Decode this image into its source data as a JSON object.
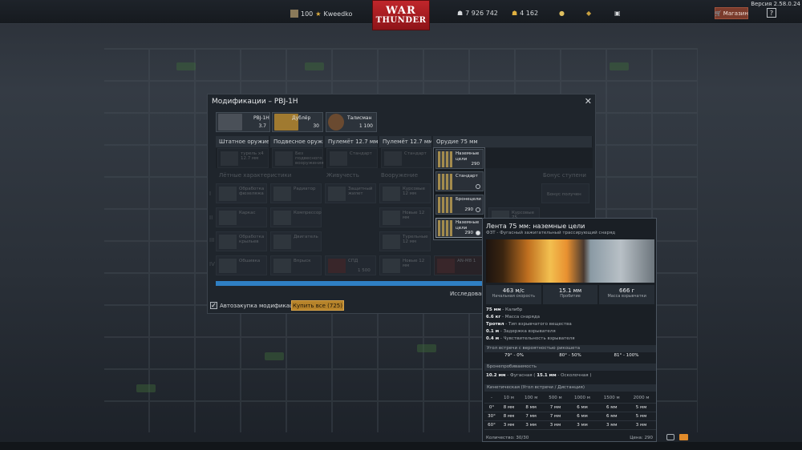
{
  "topbar": {
    "version": "Версия 2.58.0.24",
    "rank": "100",
    "username": "Kweedko",
    "silver_lions": "7 926 742",
    "golden_eagles": "4 162",
    "logo_line1": "WAR",
    "logo_line2": "THUNDER",
    "shop": "Магазин",
    "help": "?"
  },
  "dialog": {
    "title": "Модификации – PBJ-1H",
    "close": "✕",
    "slots": [
      {
        "name": "PBJ-1H",
        "value": "3.7"
      },
      {
        "name": "Дублёр",
        "value": "30"
      },
      {
        "name": "Талисман",
        "value": "1 100"
      }
    ],
    "categories": [
      "Штатное оружие",
      "Подвесное оружие",
      "Пулемёт 12.7 мм",
      "Пулемёт 12.7 мм",
      "Орудие 75 мм"
    ],
    "row1": [
      "турель x4 12.7 мм",
      "Без подвесного вооружения",
      "Стандарт",
      "Стандарт"
    ],
    "sections": [
      "Лётные характеристики",
      "Живучесть",
      "Вооружение",
      "Бонус ступени"
    ],
    "tiers": [
      "I",
      "II",
      "III",
      "IV"
    ],
    "mods": [
      "Обработка фюзеляжа",
      "Радиатор",
      "Защитный жилет",
      "Курсовые 12 мм",
      "Каркас",
      "Компрессор",
      "Новые 12 мм",
      "Курсовые 75",
      "Обработка крыльев",
      "Двигатель",
      "Турельные 12 мм",
      "Обшивка",
      "Впрыск",
      "СПД",
      "Новые 12 мм",
      "AN-M8 1"
    ],
    "bonus": "Бонус получен",
    "spd_price": "1 500",
    "research": "Исследовани",
    "autobuy": "Автозакупка модификаций",
    "buy_all": "Купить все (725)"
  },
  "dropdown": [
    {
      "name": "Наземные цели",
      "price": "290",
      "selected": false
    },
    {
      "name": "Стандарт",
      "price": "",
      "selected": false
    },
    {
      "name": "Бронецели",
      "price": "290",
      "selected": false
    },
    {
      "name": "Наземные цели",
      "price": "290",
      "selected": true
    }
  ],
  "tooltip": {
    "title": "Лента 75 мм: наземные цели",
    "subtitle": "ФЗТ - Фугасный зажигательный трассирующий снаряд",
    "stats": [
      {
        "value": "463 м/с",
        "label": "Начальная скорость"
      },
      {
        "value": "15.1 мм",
        "label": "Пробитие"
      },
      {
        "value": "666 г",
        "label": "Масса взрывчатки"
      }
    ],
    "props": [
      {
        "v": "75 мм",
        "l": "Калибр"
      },
      {
        "v": "6.6 кг",
        "l": "Масса снаряда"
      },
      {
        "v": "Тротил",
        "l": "Тип взрывчатого вещества"
      },
      {
        "v": "0.1 м",
        "l": "Задержка взрывателя"
      },
      {
        "v": "0.4 м",
        "l": "Чувствительность взрывателя"
      }
    ],
    "ricochet_head": "Угол встречи с вероятностью рикошета",
    "ricochet": [
      "79° - 0%",
      "80° - 50%",
      "81° - 100%"
    ],
    "pen_head": "Бронепробиваемость",
    "pen_value": "10.2 мм",
    "pen_type": "Фугасная",
    "pen_shrapnel": "15.1 мм",
    "pen_shrapnel_label": "Осколочная",
    "kin_head": "Кинетическая (Угол встречи / Дистанция)",
    "table": [
      [
        "-",
        "10 м",
        "100 м",
        "500 м",
        "1000 м",
        "1500 м",
        "2000 м"
      ],
      [
        "0°",
        "8 мм",
        "8 мм",
        "7 мм",
        "6 мм",
        "6 мм",
        "5 мм"
      ],
      [
        "30°",
        "8 мм",
        "7 мм",
        "7 мм",
        "6 мм",
        "6 мм",
        "5 мм"
      ],
      [
        "60°",
        "3 мм",
        "3 мм",
        "3 мм",
        "3 мм",
        "3 мм",
        "3 мм"
      ]
    ],
    "quantity": "Количество: 30/30",
    "price": "Цена: 290"
  }
}
